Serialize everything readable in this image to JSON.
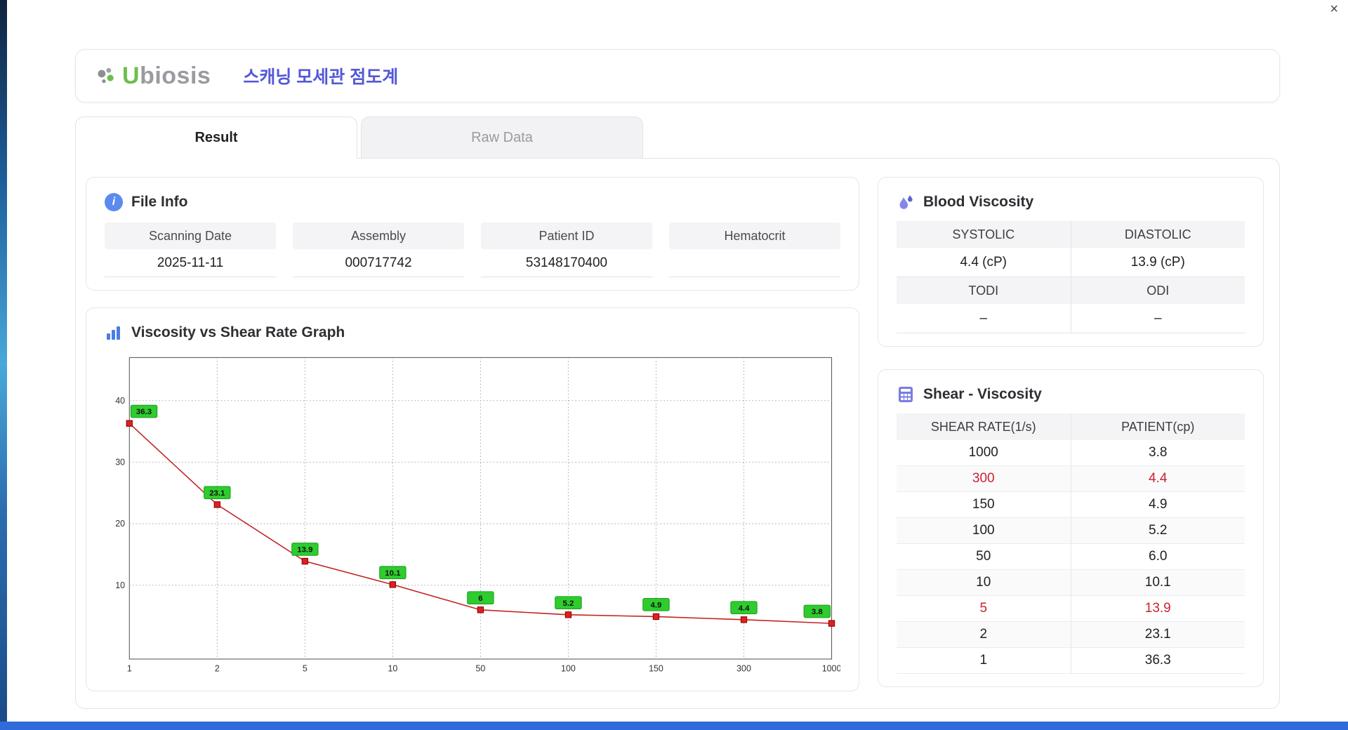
{
  "window": {
    "close_label": "×"
  },
  "header": {
    "logo_u": "U",
    "logo_rest": "biosis",
    "title": "스캐닝 모세관 점도계"
  },
  "tabs": [
    {
      "label": "Result",
      "active": true
    },
    {
      "label": "Raw Data",
      "active": false
    }
  ],
  "file_info": {
    "title": "File Info",
    "fields": [
      {
        "label": "Scanning Date",
        "value": "2025-11-11"
      },
      {
        "label": "Assembly",
        "value": "000717742"
      },
      {
        "label": "Patient ID",
        "value": "53148170400"
      },
      {
        "label": "Hematocrit",
        "value": ""
      }
    ]
  },
  "graph": {
    "title": "Viscosity vs Shear Rate Graph"
  },
  "chart_data": {
    "type": "line",
    "title": "Viscosity vs Shear Rate Graph",
    "x": [
      1,
      2,
      5,
      10,
      50,
      100,
      150,
      300,
      1000
    ],
    "x_ticks": [
      "1",
      "2",
      "5",
      "10",
      "50",
      "100",
      "150",
      "300",
      "1000"
    ],
    "x_spacing": "even",
    "values": [
      36.3,
      23.1,
      13.9,
      10.1,
      6,
      5.2,
      4.9,
      4.4,
      3.8
    ],
    "labels": [
      "36.3",
      "23.1",
      "13.9",
      "10.1",
      "6",
      "5.2",
      "4.9",
      "4.4",
      "3.8"
    ],
    "y_ticks": [
      10,
      20,
      30,
      40
    ],
    "ylim": [
      0,
      45
    ],
    "xlabel": "",
    "ylabel": "",
    "grid": "dotted",
    "legend": "none",
    "line_color": "#c22222",
    "marker_color": "#e02020",
    "marker_border": "#8b0000",
    "label_bg": "#2ecc2e",
    "label_border": "#18a018"
  },
  "blood_viscosity": {
    "title": "Blood Viscosity",
    "cells": [
      {
        "label": "SYSTOLIC",
        "value": "4.4 (cP)"
      },
      {
        "label": "DIASTOLIC",
        "value": "13.9 (cP)"
      },
      {
        "label": "TODI",
        "value": "–"
      },
      {
        "label": "ODI",
        "value": "–"
      }
    ]
  },
  "shear_viscosity": {
    "title": "Shear - Viscosity",
    "columns": [
      "SHEAR RATE(1/s)",
      "PATIENT(cp)"
    ],
    "rows": [
      {
        "shear": "1000",
        "patient": "3.8",
        "highlight": false
      },
      {
        "shear": "300",
        "patient": "4.4",
        "highlight": true
      },
      {
        "shear": "150",
        "patient": "4.9",
        "highlight": false
      },
      {
        "shear": "100",
        "patient": "5.2",
        "highlight": false
      },
      {
        "shear": "50",
        "patient": "6.0",
        "highlight": false
      },
      {
        "shear": "10",
        "patient": "10.1",
        "highlight": false
      },
      {
        "shear": "5",
        "patient": "13.9",
        "highlight": true
      },
      {
        "shear": "2",
        "patient": "23.1",
        "highlight": false
      },
      {
        "shear": "1",
        "patient": "36.3",
        "highlight": false
      }
    ]
  },
  "colors": {
    "accent_blue": "#5558d6",
    "icon_blue": "#4a7ce8",
    "icon_purple": "#7a7ce4",
    "logo_green": "#6cc04a",
    "table_red": "#cc2233"
  }
}
